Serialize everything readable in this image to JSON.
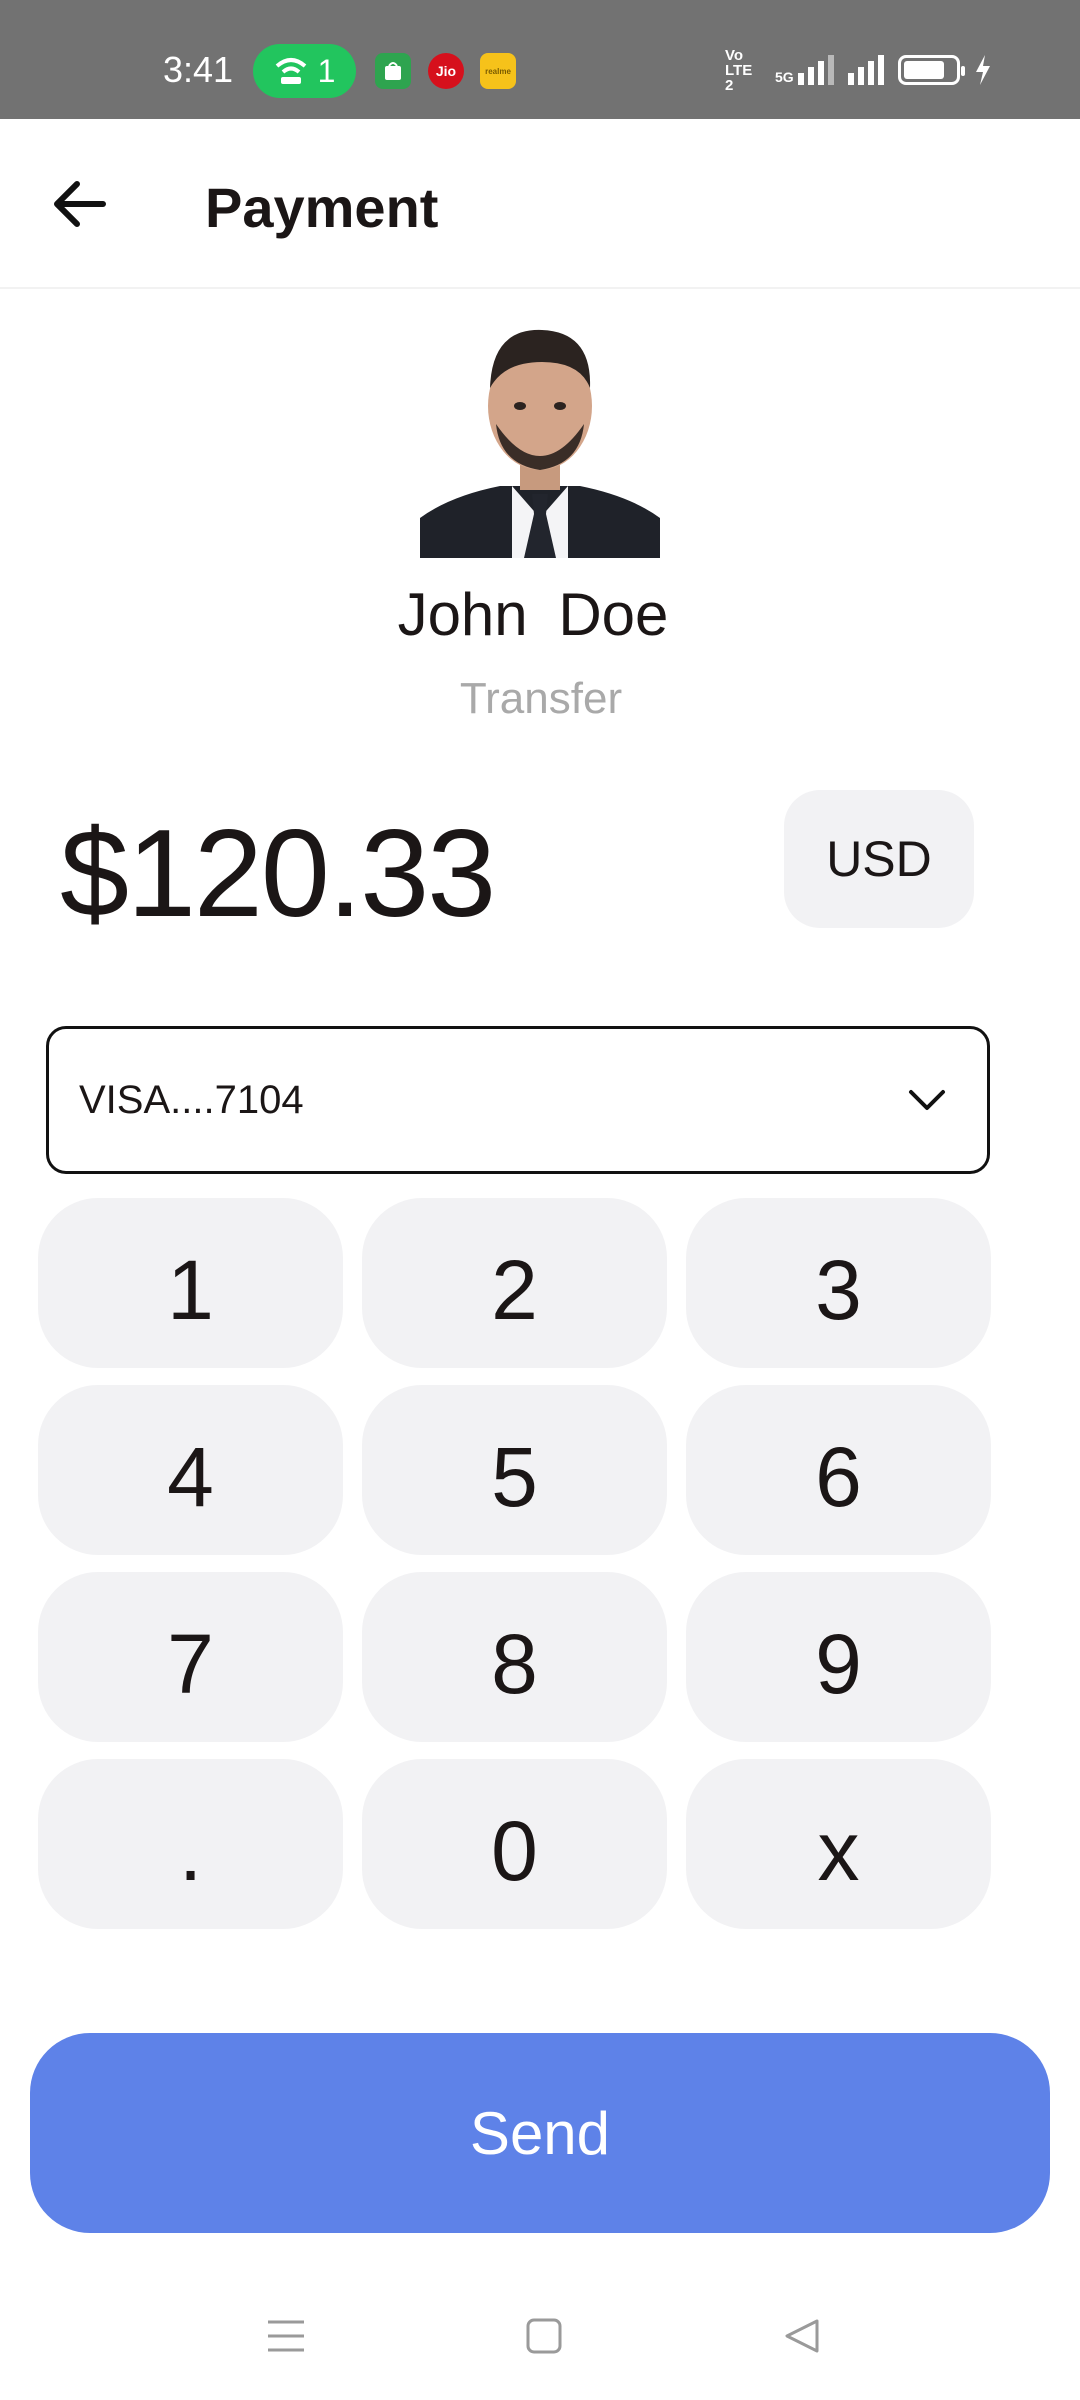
{
  "status_bar": {
    "time": "3:41",
    "hotspot_count": "1",
    "badge_jio": "Jio",
    "badge_realme": "realme",
    "network_left": "Vo LTE 2",
    "network_5g": "5G",
    "icons": [
      "wifi-hotspot-icon",
      "signal-icon",
      "battery-icon",
      "charging-icon"
    ]
  },
  "header": {
    "title": "Payment",
    "back_icon": "arrow-left-icon"
  },
  "recipient": {
    "name": "John  Doe",
    "subtitle": "Transfer"
  },
  "amount": {
    "value": "$120.33",
    "currency": "USD"
  },
  "payment_method": {
    "selected": "VISA....7104",
    "icon": "chevron-down-icon"
  },
  "keypad": {
    "keys": [
      "1",
      "2",
      "3",
      "4",
      "5",
      "6",
      "7",
      "8",
      "9",
      ".",
      "0",
      "x"
    ]
  },
  "actions": {
    "send_label": "Send"
  },
  "nav_bar": {
    "icons": [
      "menu-icon",
      "home-icon",
      "back-icon"
    ]
  },
  "colors": {
    "accent": "#5e82e8",
    "key_background": "#f2f2f4",
    "status_bar": "#727272"
  }
}
